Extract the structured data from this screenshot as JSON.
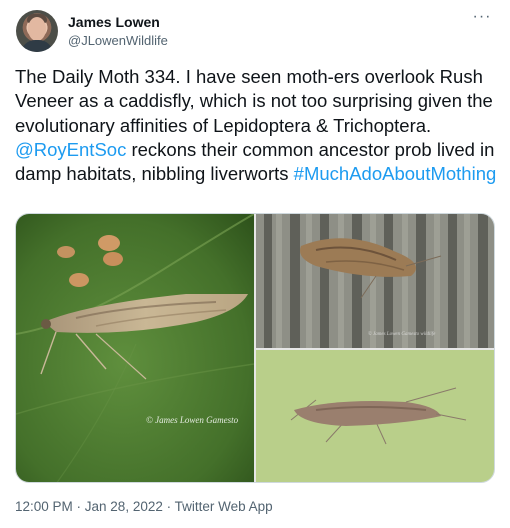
{
  "author": {
    "name": "James Lowen",
    "handle": "@JLowenWildlife"
  },
  "more_menu_glyph": "···",
  "tweet": {
    "text_part1": "The Daily Moth 334. I have seen moth-ers overlook Rush Veneer as a caddisfly, which is not too surprising given the evolutionary affinities of Lepidoptera & Trichoptera. ",
    "mention": "@RoyEntSoc",
    "text_part2": " reckons their common ancestor prob lived in damp habitats, nibbling liverworts ",
    "hashtag": "#MuchAdoAboutMothing"
  },
  "media": {
    "photo1_watermark": "© James Lowen Gamesto",
    "photo2_watermark": "© James Lowen Gamesto wildlife"
  },
  "meta": {
    "timestamp": "12:00 PM · Jan 28, 2022 · Twitter Web App"
  },
  "colors": {
    "link": "#1d9bf0",
    "text": "#0f1419",
    "secondary": "#536471"
  }
}
